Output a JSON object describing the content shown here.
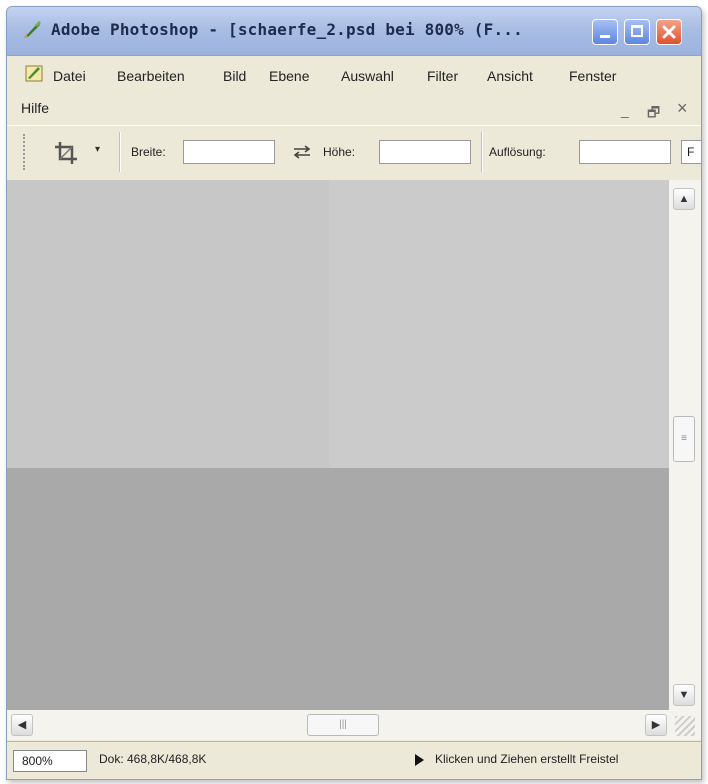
{
  "window": {
    "title": "Adobe Photoshop - [schaerfe_2.psd bei 800% (F...",
    "icons": [
      "photoshop-feather-icon",
      "minimize-icon",
      "maximize-icon",
      "close-icon"
    ]
  },
  "menu": {
    "items": [
      "Datei",
      "Bearbeiten",
      "Bild",
      "Ebene",
      "Auswahl",
      "Filter",
      "Ansicht",
      "Fenster",
      "Hilfe"
    ],
    "doc_controls": {
      "minimize": "_",
      "restore": "🗗",
      "close": "×"
    }
  },
  "options": {
    "tool_icon": "crop-tool-icon",
    "width_label": "Breite:",
    "width_value": "",
    "swap_icon": "swap-arrows-icon",
    "height_label": "Höhe:",
    "height_value": "",
    "resolution_label": "Auflösung:",
    "resolution_value": "",
    "overflow_char": "F"
  },
  "scrollbar": {
    "up": "▲",
    "down": "▼",
    "left": "◀",
    "right": "▶",
    "thumb_grip_v": "≡",
    "thumb_grip_h": "|||"
  },
  "status": {
    "zoom": "800%",
    "doc_info": "Dok: 468,8K/468,8K",
    "hint": "Klicken und Ziehen erstellt Freistel"
  }
}
